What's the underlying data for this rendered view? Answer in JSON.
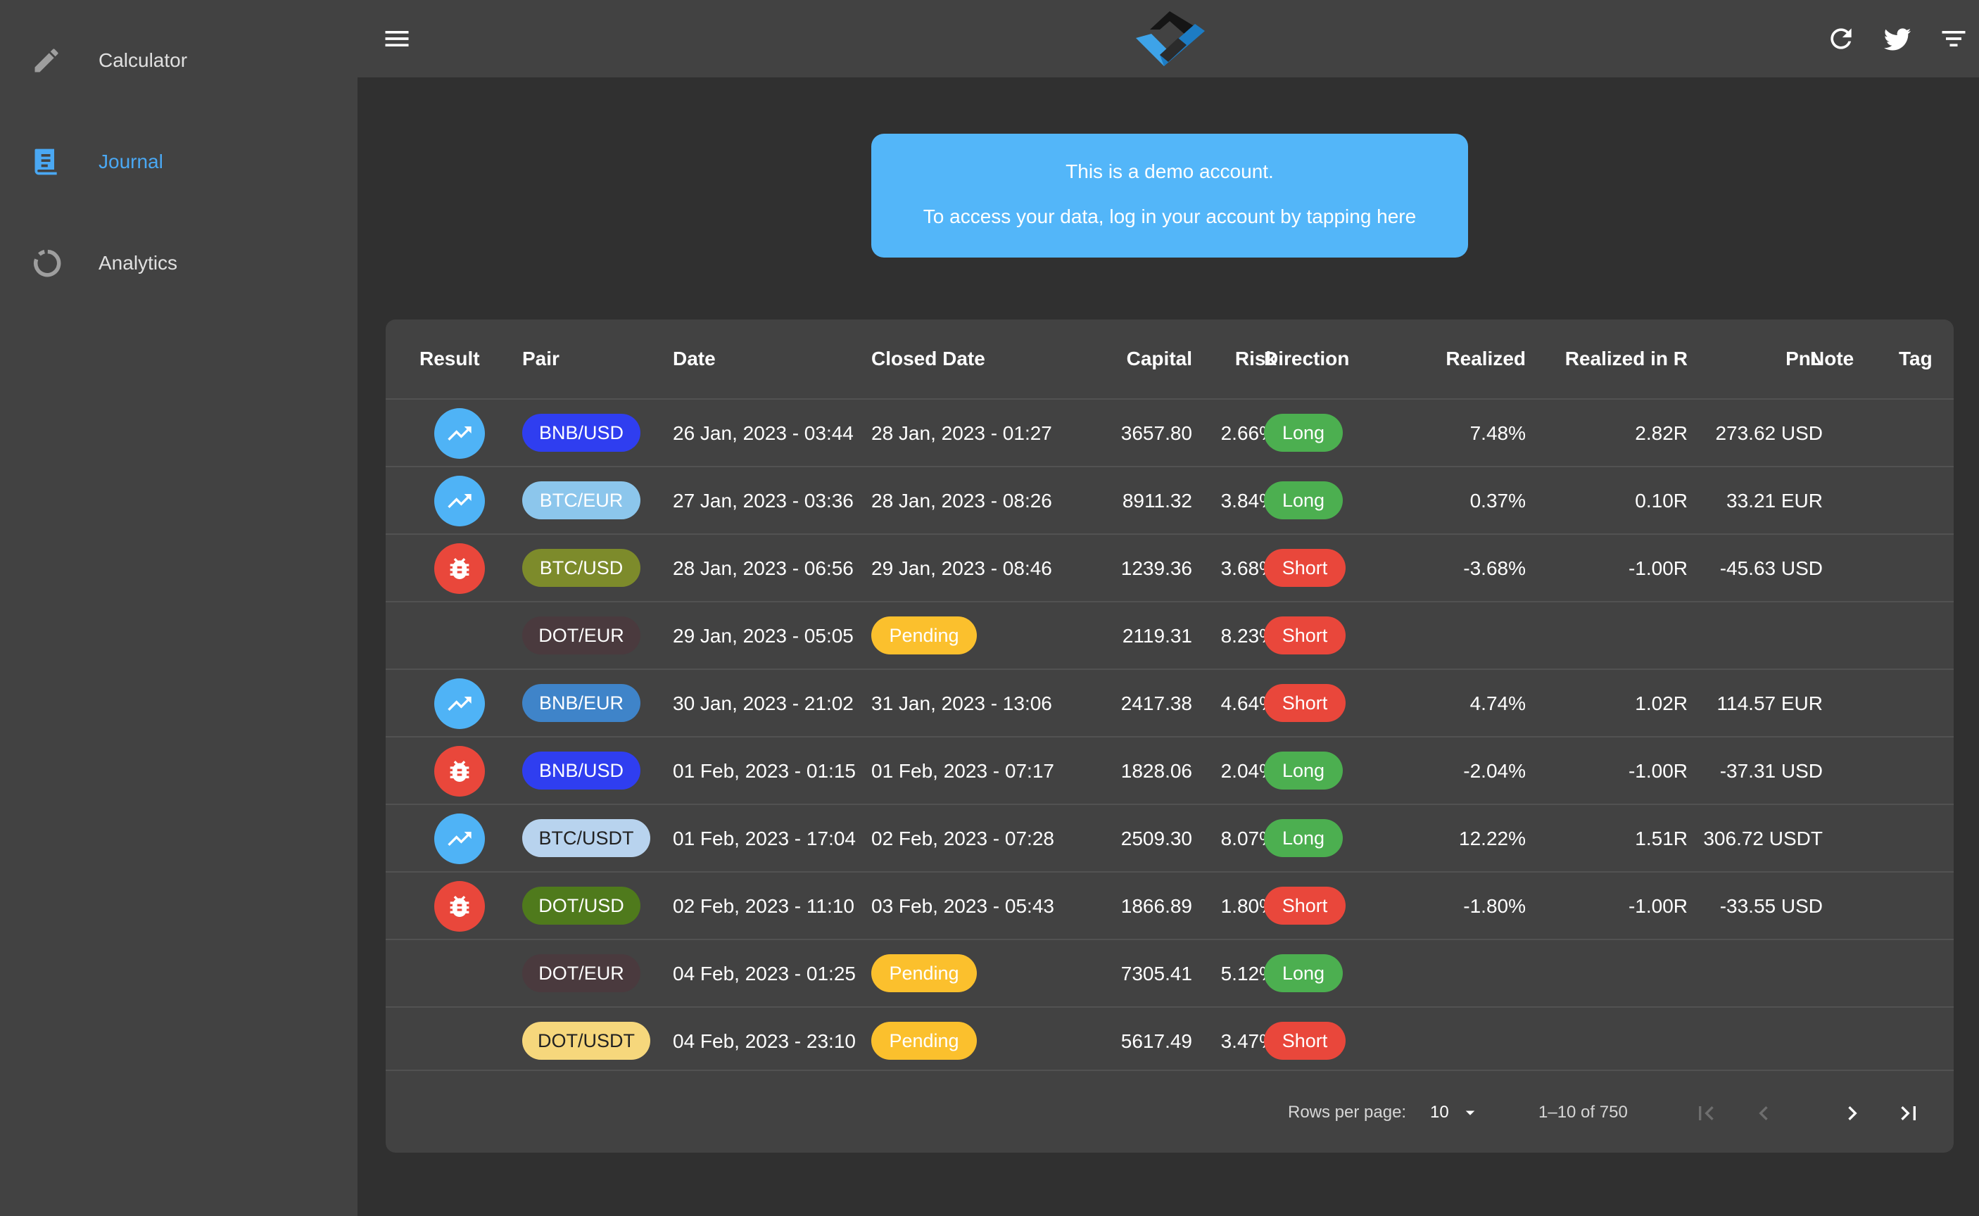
{
  "sidebar": {
    "items": [
      {
        "label": "Calculator",
        "icon": "pencil-icon"
      },
      {
        "label": "Journal",
        "icon": "journal-icon",
        "active": true
      },
      {
        "label": "Analytics",
        "icon": "donut-chart-icon"
      }
    ]
  },
  "topbar": {
    "icons": [
      "menu-icon",
      "app-logo",
      "refresh-icon",
      "twitter-icon",
      "filter-icon"
    ]
  },
  "banner": {
    "line1": "This is a demo account.",
    "line2": "To access your data, log in your account by tapping here"
  },
  "table": {
    "columns": [
      "Result",
      "Pair",
      "Date",
      "Closed Date",
      "Capital",
      "Risk",
      "Direction",
      "Realized",
      "Realized in R",
      "PnL",
      "Note",
      "Tag"
    ],
    "rows": [
      {
        "result": "win",
        "pair": "BNB/USD",
        "date": "26 Jan, 2023 - 03:44",
        "closed": "28 Jan, 2023 - 01:27",
        "capital": "3657.80",
        "risk": "2.66%",
        "direction": "Long",
        "realized": "7.48%",
        "realized_r": "2.82R",
        "pnl": "273.62 USD"
      },
      {
        "result": "win",
        "pair": "BTC/EUR",
        "date": "27 Jan, 2023 - 03:36",
        "closed": "28 Jan, 2023 - 08:26",
        "capital": "8911.32",
        "risk": "3.84%",
        "direction": "Long",
        "realized": "0.37%",
        "realized_r": "0.10R",
        "pnl": "33.21 EUR"
      },
      {
        "result": "loss",
        "pair": "BTC/USD",
        "date": "28 Jan, 2023 - 06:56",
        "closed": "29 Jan, 2023 - 08:46",
        "capital": "1239.36",
        "risk": "3.68%",
        "direction": "Short",
        "realized": "-3.68%",
        "realized_r": "-1.00R",
        "pnl": "-45.63 USD"
      },
      {
        "result": "",
        "pair": "DOT/EUR",
        "date": "29 Jan, 2023 - 05:05",
        "closed": "Pending",
        "capital": "2119.31",
        "risk": "8.23%",
        "direction": "Short",
        "realized": "",
        "realized_r": "",
        "pnl": ""
      },
      {
        "result": "win",
        "pair": "BNB/EUR",
        "date": "30 Jan, 2023 - 21:02",
        "closed": "31 Jan, 2023 - 13:06",
        "capital": "2417.38",
        "risk": "4.64%",
        "direction": "Short",
        "realized": "4.74%",
        "realized_r": "1.02R",
        "pnl": "114.57 EUR"
      },
      {
        "result": "loss",
        "pair": "BNB/USD",
        "date": "01 Feb, 2023 - 01:15",
        "closed": "01 Feb, 2023 - 07:17",
        "capital": "1828.06",
        "risk": "2.04%",
        "direction": "Long",
        "realized": "-2.04%",
        "realized_r": "-1.00R",
        "pnl": "-37.31 USD"
      },
      {
        "result": "win",
        "pair": "BTC/USDT",
        "date": "01 Feb, 2023 - 17:04",
        "closed": "02 Feb, 2023 - 07:28",
        "capital": "2509.30",
        "risk": "8.07%",
        "direction": "Long",
        "realized": "12.22%",
        "realized_r": "1.51R",
        "pnl": "306.72 USDT"
      },
      {
        "result": "loss",
        "pair": "DOT/USD",
        "date": "02 Feb, 2023 - 11:10",
        "closed": "03 Feb, 2023 - 05:43",
        "capital": "1866.89",
        "risk": "1.80%",
        "direction": "Short",
        "realized": "-1.80%",
        "realized_r": "-1.00R",
        "pnl": "-33.55 USD"
      },
      {
        "result": "",
        "pair": "DOT/EUR",
        "date": "04 Feb, 2023 - 01:25",
        "closed": "Pending",
        "capital": "7305.41",
        "risk": "5.12%",
        "direction": "Long",
        "realized": "",
        "realized_r": "",
        "pnl": ""
      },
      {
        "result": "",
        "pair": "DOT/USDT",
        "date": "04 Feb, 2023 - 23:10",
        "closed": "Pending",
        "capital": "5617.49",
        "risk": "3.47%",
        "direction": "Short",
        "realized": "",
        "realized_r": "",
        "pnl": ""
      }
    ]
  },
  "pagination": {
    "rows_per_page_label": "Rows per page:",
    "rows_per_page": "10",
    "range": "1–10 of 750"
  },
  "colors": {
    "win": "#4fb3f6",
    "loss": "#e9473b",
    "long": "#4caf50",
    "short": "#e9473b",
    "pending": "#fbc02d",
    "pairs": {
      "BNB/USD": {
        "bg": "#2f3ef0",
        "fg": "#ffffff"
      },
      "BTC/EUR": {
        "bg": "#8cc6ec",
        "fg": "#ffffff"
      },
      "BTC/USD": {
        "bg": "#7d8b2b",
        "fg": "#ffffff"
      },
      "DOT/EUR": {
        "bg": "#4a3a3e",
        "fg": "#ffffff"
      },
      "BNB/EUR": {
        "bg": "#3f84c9",
        "fg": "#ffffff"
      },
      "BTC/USDT": {
        "bg": "#b8d3ee",
        "fg": "#222222"
      },
      "DOT/USD": {
        "bg": "#4f7a1c",
        "fg": "#ffffff"
      },
      "DOT/USDT": {
        "bg": "#f6d77c",
        "fg": "#222222"
      }
    }
  }
}
